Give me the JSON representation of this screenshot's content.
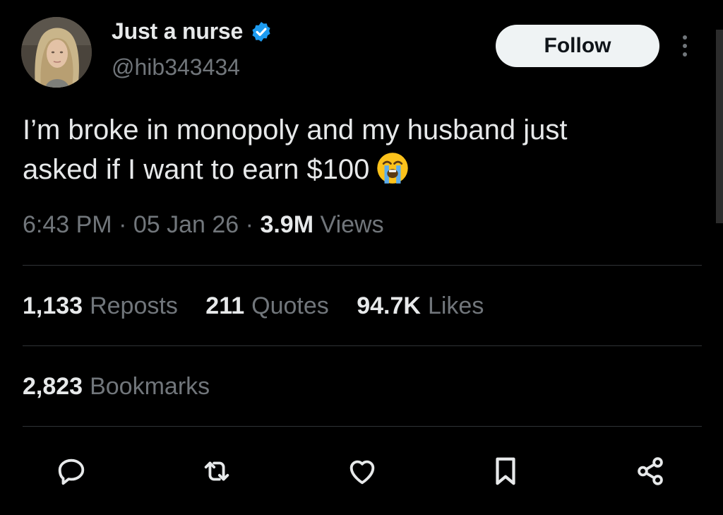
{
  "author": {
    "display_name": "Just a nurse",
    "handle": "@hib343434",
    "verified": true,
    "verified_color": "#1d9bf0",
    "avatar_icon": "profile-photo-avatar"
  },
  "header": {
    "follow_label": "Follow",
    "more_icon": "more-vertical-icon"
  },
  "tweet": {
    "text_line1": "I’m broke in monopoly and my husband just",
    "text_line2": "asked if I want to earn $100",
    "emoji": "loudly-crying-face"
  },
  "meta": {
    "time": "6:43 PM",
    "separator": "·",
    "date": "05 Jan 26",
    "views_count": "3.9M",
    "views_label": "Views"
  },
  "stats": {
    "reposts_count": "1,133",
    "reposts_label": "Reposts",
    "quotes_count": "211",
    "quotes_label": "Quotes",
    "likes_count": "94.7K",
    "likes_label": "Likes",
    "bookmarks_count": "2,823",
    "bookmarks_label": "Bookmarks"
  },
  "actions": {
    "icons": [
      "reply-icon",
      "repost-icon",
      "like-icon",
      "bookmark-icon",
      "share-icon"
    ]
  },
  "colors": {
    "background": "#000000",
    "text_primary": "#e7e9ea",
    "text_secondary": "#71767b",
    "divider": "#2f3336",
    "follow_bg": "#eff3f4"
  }
}
